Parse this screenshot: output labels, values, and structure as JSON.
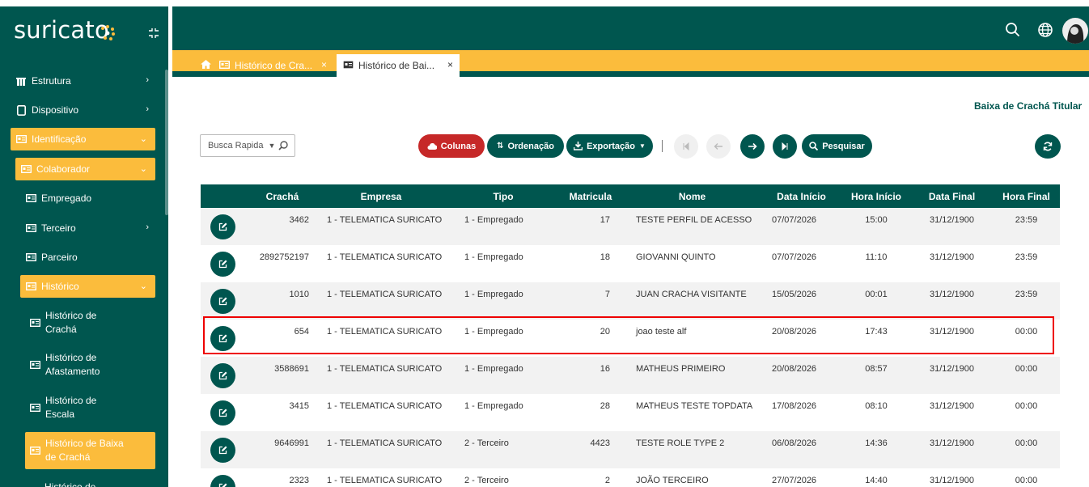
{
  "app": {
    "logo_text": "suricato"
  },
  "sidebar": {
    "items": [
      {
        "label": "Estrutura"
      },
      {
        "label": "Dispositivo"
      },
      {
        "label": "Identificação"
      },
      {
        "label": "Colaborador"
      },
      {
        "label": "Empregado"
      },
      {
        "label": "Terceiro"
      },
      {
        "label": "Parceiro"
      },
      {
        "label": "Histórico"
      },
      {
        "label": "Histórico de Crachá"
      },
      {
        "label": "Histórico de Afastamento"
      },
      {
        "label": "Histórico de Escala"
      },
      {
        "label": "Histórico de Baixa de Crachá"
      },
      {
        "label": "Histórico de"
      }
    ]
  },
  "tabs": [
    {
      "label": "Histórico de Cra...",
      "close": "×"
    },
    {
      "label": "Histórico de Bai...",
      "close": "×"
    }
  ],
  "page_title": "Baixa de Crachá Titular",
  "toolbar": {
    "quick_search": "Busca Rapida",
    "columns": "Colunas",
    "ordering": "Ordenação",
    "export": "Exportação",
    "search": "Pesquisar"
  },
  "colors": {
    "primary": "#00564f",
    "accent": "#fbbc3c",
    "danger": "#c62828"
  },
  "table": {
    "headers": [
      "",
      "Crachá",
      "Empresa",
      "Tipo",
      "Matricula",
      "Nome",
      "Data Início",
      "Hora Início",
      "Data Final",
      "Hora Final"
    ],
    "rows": [
      {
        "cracha": "3462",
        "empresa": "1 - TELEMATICA SURICATO",
        "tipo": "1 - Empregado",
        "matricula": "17",
        "nome": "TESTE PERFIL DE ACESSO",
        "data_inicio": "07/07/2026",
        "hora_inicio": "15:00",
        "data_final": "31/12/1900",
        "hora_final": "23:59"
      },
      {
        "cracha": "2892752197",
        "empresa": "1 - TELEMATICA SURICATO",
        "tipo": "1 - Empregado",
        "matricula": "18",
        "nome": "GIOVANNI QUINTO",
        "data_inicio": "07/07/2026",
        "hora_inicio": "11:10",
        "data_final": "31/12/1900",
        "hora_final": "23:59"
      },
      {
        "cracha": "1010",
        "empresa": "1 - TELEMATICA SURICATO",
        "tipo": "1 - Empregado",
        "matricula": "7",
        "nome": "JUAN CRACHA VISITANTE",
        "data_inicio": "15/05/2026",
        "hora_inicio": "00:01",
        "data_final": "31/12/1900",
        "hora_final": "23:59"
      },
      {
        "cracha": "654",
        "empresa": "1 - TELEMATICA SURICATO",
        "tipo": "1 - Empregado",
        "matricula": "20",
        "nome": "joao teste alf",
        "data_inicio": "20/08/2026",
        "hora_inicio": "17:43",
        "data_final": "31/12/1900",
        "hora_final": "00:00"
      },
      {
        "cracha": "3588691",
        "empresa": "1 - TELEMATICA SURICATO",
        "tipo": "1 - Empregado",
        "matricula": "16",
        "nome": "MATHEUS PRIMEIRO",
        "data_inicio": "20/08/2026",
        "hora_inicio": "08:57",
        "data_final": "31/12/1900",
        "hora_final": "00:00"
      },
      {
        "cracha": "3415",
        "empresa": "1 - TELEMATICA SURICATO",
        "tipo": "1 - Empregado",
        "matricula": "28",
        "nome": "MATHEUS TESTE TOPDATA",
        "data_inicio": "17/08/2026",
        "hora_inicio": "08:10",
        "data_final": "31/12/1900",
        "hora_final": "00:00"
      },
      {
        "cracha": "9646991",
        "empresa": "1 - TELEMATICA SURICATO",
        "tipo": "2 - Terceiro",
        "matricula": "4423",
        "nome": "TESTE ROLE TYPE 2",
        "data_inicio": "06/08/2026",
        "hora_inicio": "14:36",
        "data_final": "31/12/1900",
        "hora_final": "00:00"
      },
      {
        "cracha": "2323",
        "empresa": "1 - TELEMATICA SURICATO",
        "tipo": "2 - Terceiro",
        "matricula": "2",
        "nome": "JOÃO TERCEIRO",
        "data_inicio": "27/07/2026",
        "hora_inicio": "14:40",
        "data_final": "31/12/1900",
        "hora_final": "00:00"
      }
    ]
  }
}
